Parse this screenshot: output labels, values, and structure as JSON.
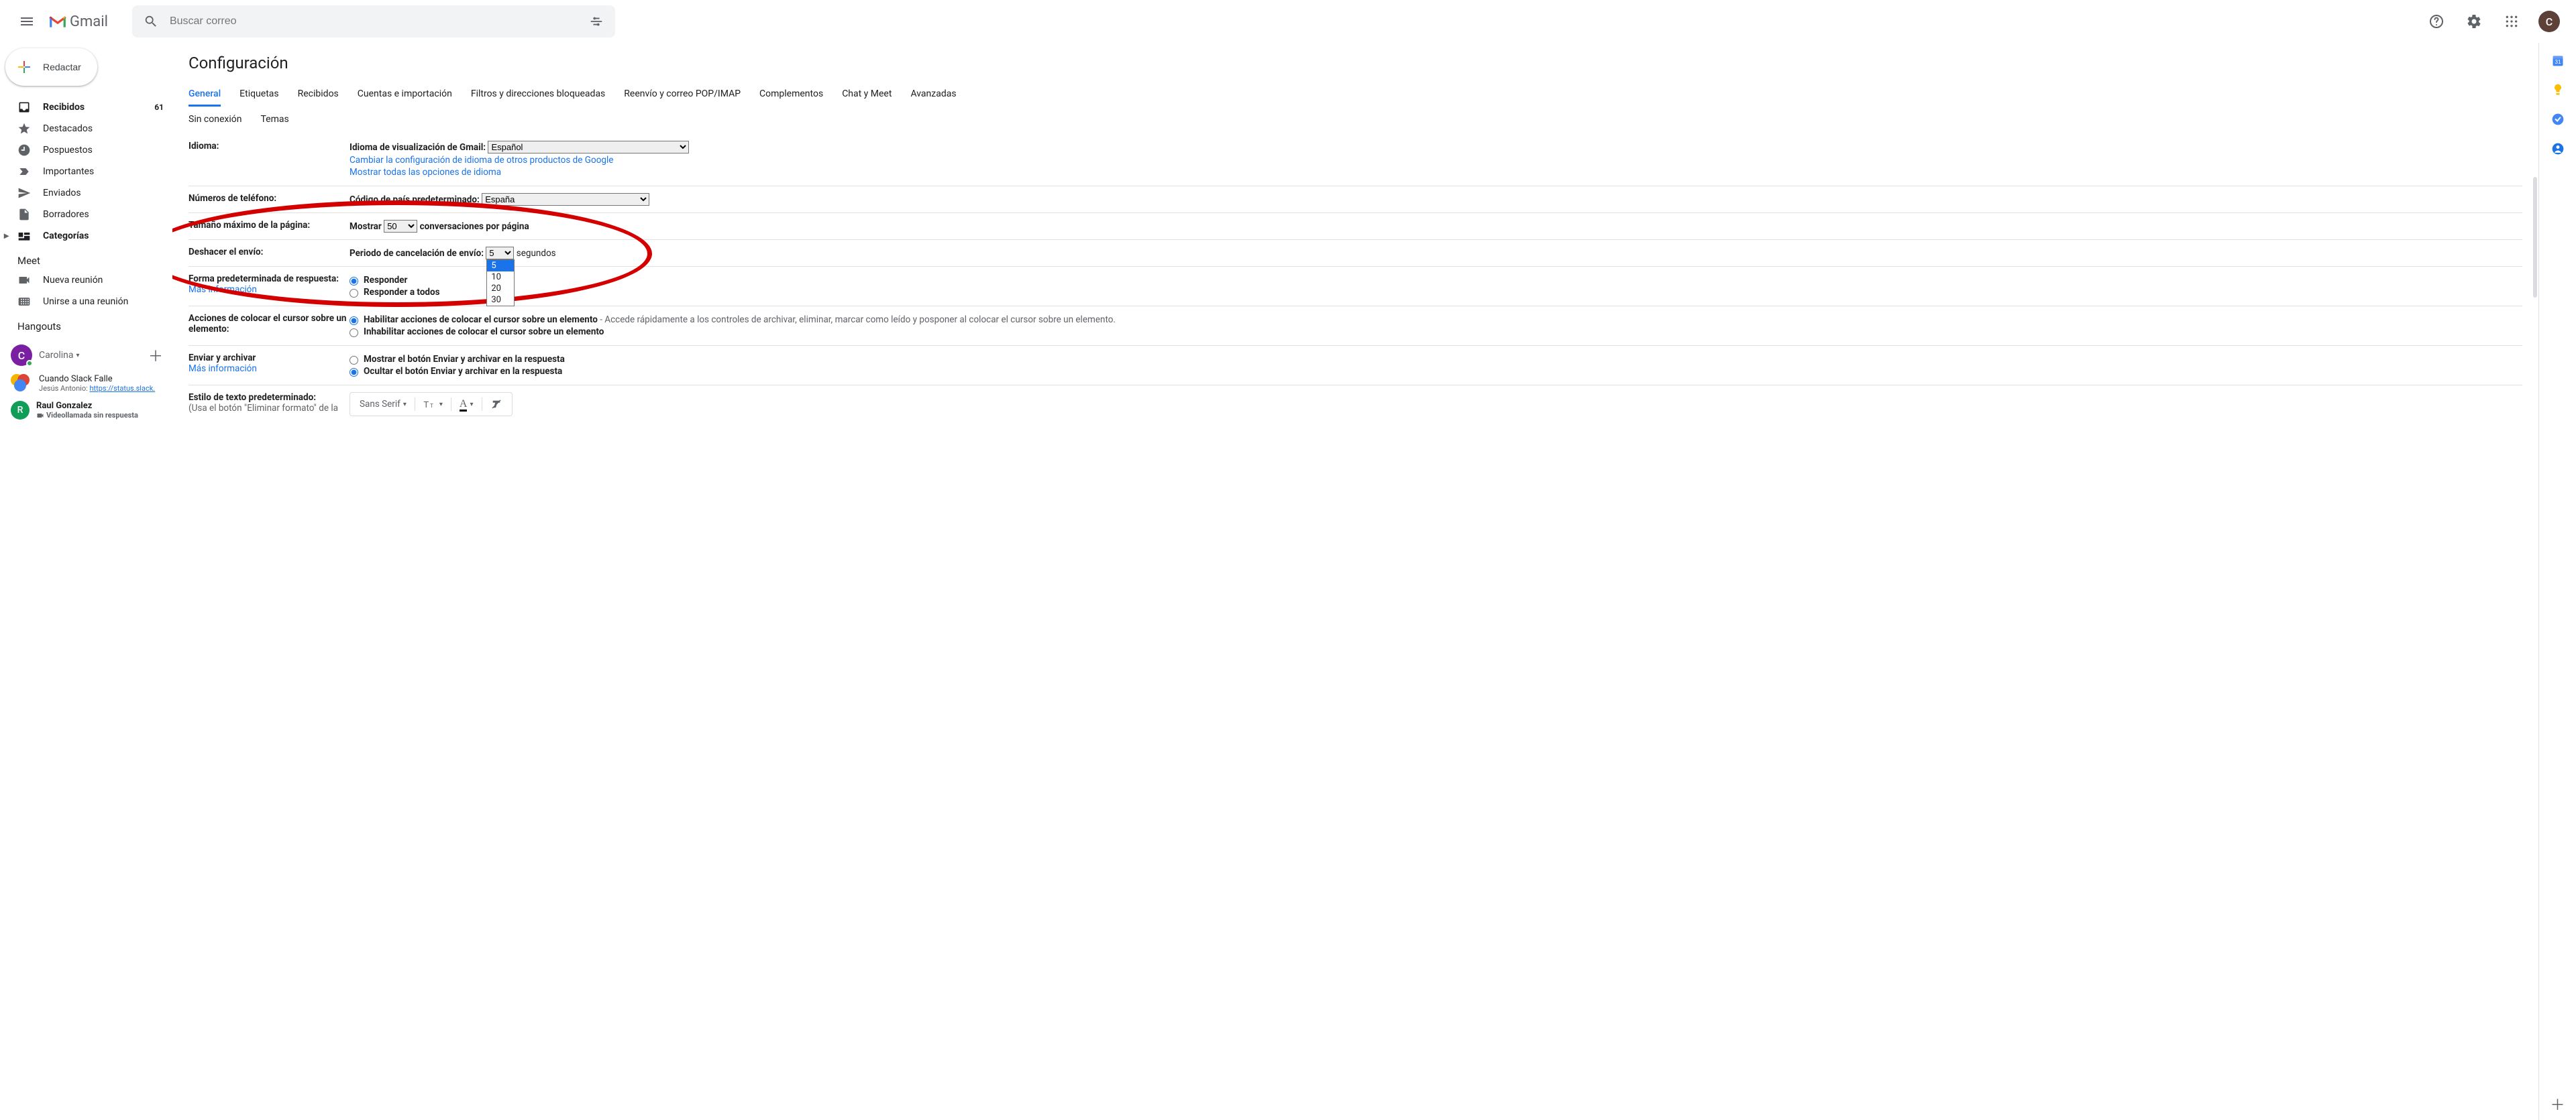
{
  "header": {
    "product": "Gmail",
    "search_placeholder": "Buscar correo",
    "avatar_initial": "C"
  },
  "compose_label": "Redactar",
  "nav": [
    {
      "icon": "inbox",
      "label": "Recibidos",
      "count": "61",
      "bold": true
    },
    {
      "icon": "star",
      "label": "Destacados"
    },
    {
      "icon": "clock",
      "label": "Pospuestos"
    },
    {
      "icon": "important",
      "label": "Importantes"
    },
    {
      "icon": "send",
      "label": "Enviados"
    },
    {
      "icon": "draft",
      "label": "Borradores"
    },
    {
      "icon": "categories",
      "label": "Categorías",
      "bold": true,
      "caret": true
    }
  ],
  "meet_header": "Meet",
  "meet": [
    {
      "icon": "video",
      "label": "Nueva reunión"
    },
    {
      "icon": "keyboard",
      "label": "Unirse a una reunión"
    }
  ],
  "hangouts_header": "Hangouts",
  "hangouts_user": {
    "initial": "C",
    "name": "Carolina"
  },
  "chats": [
    {
      "type": "group",
      "title": "Cuando Slack Falle",
      "sub_prefix": "Jesús Antonio: ",
      "sub_link": "https://status.slack."
    },
    {
      "type": "dm",
      "initial": "R",
      "title": "Raul Gonzalez",
      "sub": "Videollamada sin respuesta",
      "bold": true,
      "missed": true
    }
  ],
  "settings_title": "Configuración",
  "tabs": [
    "General",
    "Etiquetas",
    "Recibidos",
    "Cuentas e importación",
    "Filtros y direcciones bloqueadas",
    "Reenvío y correo POP/IMAP",
    "Complementos",
    "Chat y Meet",
    "Avanzadas"
  ],
  "subtabs": [
    "Sin conexión",
    "Temas"
  ],
  "rows": {
    "idioma": {
      "label": "Idioma:",
      "display_label": "Idioma de visualización de Gmail:",
      "display_value": "Español",
      "link1": "Cambiar la configuración de idioma de otros productos de Google",
      "link2": "Mostrar todas las opciones de idioma"
    },
    "telefono": {
      "label": "Números de teléfono:",
      "code_label": "Código de país predeterminado:",
      "code_value": "España"
    },
    "pagina": {
      "label": "Tamaño máximo de la página:",
      "show": "Mostrar",
      "per_page_value": "50",
      "suffix": "conversaciones por página"
    },
    "deshacer": {
      "label": "Deshacer el envío:",
      "period_label": "Periodo de cancelación de envío:",
      "value": "5",
      "options": [
        "5",
        "10",
        "20",
        "30"
      ],
      "suffix": "segundos"
    },
    "respuesta": {
      "label": "Forma predeterminada de respuesta:",
      "more": "Más información",
      "opt1": "Responder",
      "opt2": "Responder a todos"
    },
    "hover": {
      "label": "Acciones de colocar el cursor sobre un elemento:",
      "opt1_bold": "Habilitar acciones de colocar el cursor sobre un elemento",
      "opt1_desc": " - Accede rápidamente a los controles de archivar, eliminar, marcar como leído y posponer al colocar el cursor sobre un elemento.",
      "opt2": "Inhabilitar acciones de colocar el cursor sobre un elemento"
    },
    "archivar": {
      "label": "Enviar y archivar",
      "more": "Más información",
      "opt1": "Mostrar el botón Enviar y archivar en la respuesta",
      "opt2": "Ocultar el botón Enviar y archivar en la respuesta"
    },
    "estilo": {
      "label": "Estilo de texto predeterminado:",
      "sub": "(Usa el botón \"Eliminar formato\" de la",
      "font": "Sans Serif"
    }
  }
}
